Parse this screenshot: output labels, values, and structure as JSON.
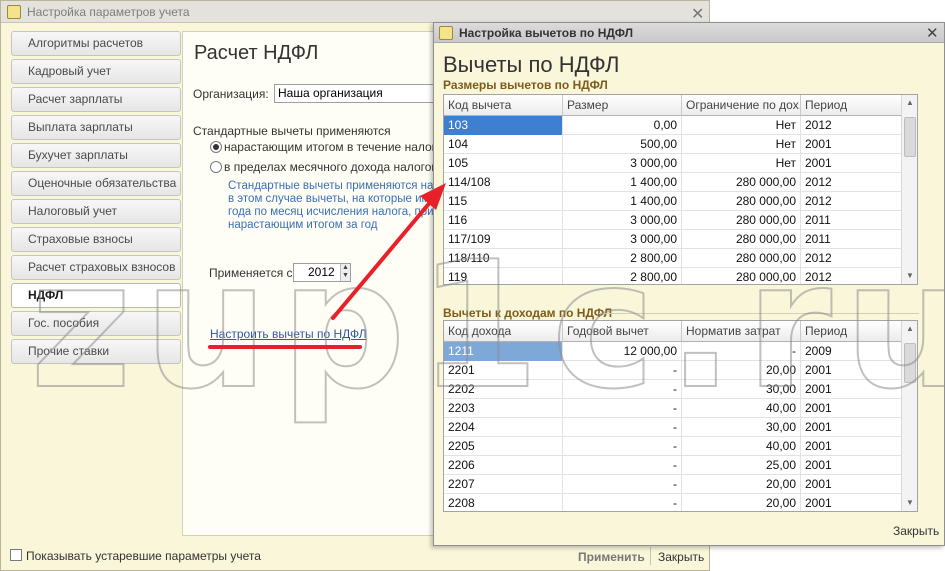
{
  "back_window": {
    "title": "Настройка параметров учета",
    "nav": [
      {
        "label": "Алгоритмы расчетов",
        "active": false
      },
      {
        "label": "Кадровый учет",
        "active": false
      },
      {
        "label": "Расчет зарплаты",
        "active": false
      },
      {
        "label": "Выплата зарплаты",
        "active": false
      },
      {
        "label": "Бухучет зарплаты",
        "active": false
      },
      {
        "label": "Оценочные обязательства",
        "active": false
      },
      {
        "label": "Налоговый учет",
        "active": false
      },
      {
        "label": "Страховые взносы",
        "active": false
      },
      {
        "label": "Расчет страховых взносов",
        "active": false
      },
      {
        "label": "НДФЛ",
        "active": true
      },
      {
        "label": "Гос. пособия",
        "active": false
      },
      {
        "label": "Прочие ставки",
        "active": false
      }
    ],
    "content": {
      "title": "Расчет НДФЛ",
      "org_label": "Организация:",
      "org_value": "Наша организация",
      "std_heading": "Стандартные вычеты применяются",
      "radio1_label": "нарастающим итогом в течение налогово",
      "radio2_label": "в пределах месячного дохода налогопла",
      "hint_lines": [
        "Стандартные вычеты применяются нара",
        "в этом случае вычеты, на которые имее",
        "года по месяц исчисления налога, при",
        "нарастающим итогом за год"
      ],
      "applies_label": "Применяется с:",
      "applies_year": "2012",
      "setup_link": "Настроить вычеты по НДФЛ"
    },
    "footer": {
      "checkbox_label": "Показывать устаревшие параметры учета",
      "apply": "Применить",
      "close": "Закрыть"
    }
  },
  "front_window": {
    "title": "Настройка вычетов по НДФЛ",
    "heading": "Вычеты по НДФЛ",
    "section1": {
      "title": "Размеры вычетов по НДФЛ",
      "columns": [
        "Код вычета",
        "Размер",
        "Ограничение по дох...",
        "Период"
      ],
      "rows": [
        [
          "103",
          "0,00",
          "Нет",
          "2012"
        ],
        [
          "104",
          "500,00",
          "Нет",
          "2001"
        ],
        [
          "105",
          "3 000,00",
          "Нет",
          "2001"
        ],
        [
          "114/108",
          "1 400,00",
          "280 000,00",
          "2012"
        ],
        [
          "115",
          "1 400,00",
          "280 000,00",
          "2012"
        ],
        [
          "116",
          "3 000,00",
          "280 000,00",
          "2011"
        ],
        [
          "117/109",
          "3 000,00",
          "280 000,00",
          "2011"
        ],
        [
          "118/110",
          "2 800,00",
          "280 000,00",
          "2012"
        ],
        [
          "119",
          "2 800,00",
          "280 000,00",
          "2012"
        ]
      ]
    },
    "section2": {
      "title": "Вычеты к доходам по НДФЛ",
      "columns": [
        "Код дохода",
        "Годовой вычет",
        "Норматив затрат",
        "Период"
      ],
      "rows": [
        [
          "1211",
          "12 000,00",
          "-",
          "2009"
        ],
        [
          "2201",
          "-",
          "20,00",
          "2001"
        ],
        [
          "2202",
          "-",
          "30,00",
          "2001"
        ],
        [
          "2203",
          "-",
          "40,00",
          "2001"
        ],
        [
          "2204",
          "-",
          "30,00",
          "2001"
        ],
        [
          "2205",
          "-",
          "40,00",
          "2001"
        ],
        [
          "2206",
          "-",
          "25,00",
          "2001"
        ],
        [
          "2207",
          "-",
          "20,00",
          "2001"
        ],
        [
          "2208",
          "-",
          "20,00",
          "2001"
        ]
      ]
    },
    "close": "Закрыть"
  },
  "watermark": "zup1c.ru",
  "colors": {
    "annotation": "#e8202a",
    "selection": "#3e7fd1",
    "link": "#2f57a6",
    "hint": "#3a6fb5"
  }
}
